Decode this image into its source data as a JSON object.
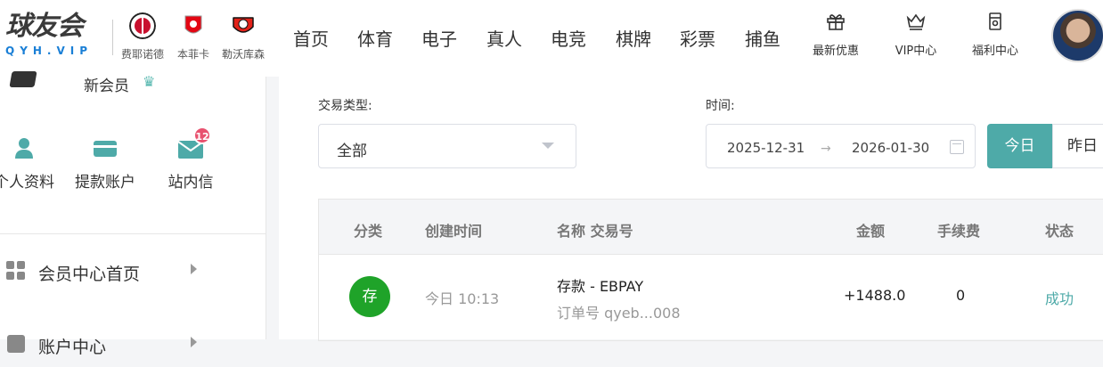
{
  "logo": {
    "main": "球友会",
    "sub": "QYH.VIP"
  },
  "clubs": [
    {
      "name": "费耶诺德",
      "color": "#c8102e"
    },
    {
      "name": "本菲卡",
      "color": "#e30613"
    },
    {
      "name": "勒沃库森",
      "color": "#e32219"
    }
  ],
  "nav": [
    "首页",
    "体育",
    "电子",
    "真人",
    "电竞",
    "棋牌",
    "彩票",
    "捕鱼"
  ],
  "utils": [
    {
      "label": "最新优惠",
      "icon": "gift-icon"
    },
    {
      "label": "VIP中心",
      "icon": "crown-icon"
    },
    {
      "label": "福利中心",
      "icon": "welfare-icon"
    }
  ],
  "sidebar": {
    "member_label": "新会员",
    "quick_actions": [
      {
        "label": "个人资料",
        "icon": "user-icon"
      },
      {
        "label": "提款账户",
        "icon": "card-icon"
      },
      {
        "label": "站内信",
        "icon": "mail-icon",
        "badge": "12"
      }
    ],
    "menu": [
      {
        "label": "会员中心首页",
        "icon": "grid-icon"
      },
      {
        "label": "账户中心",
        "icon": "account-icon"
      }
    ]
  },
  "filters": {
    "type_label": "交易类型:",
    "type_value": "全部",
    "time_label": "时间:",
    "date_start": "2025-12-31",
    "date_sep": "→",
    "date_end": "2026-01-30",
    "today": "今日",
    "yesterday": "昨日"
  },
  "table": {
    "headers": [
      "分类",
      "创建时间",
      "名称 交易号",
      "金额",
      "手续费",
      "状态"
    ],
    "rows": [
      {
        "type": "存",
        "time": "今日 10:13",
        "name": "存款 - EBPAY",
        "order": "订单号 qyeb...008",
        "amount": "+1488.0",
        "fee": "0",
        "status": "成功"
      }
    ]
  },
  "colors": {
    "accent": "#4eaaa8",
    "deposit": "#1fa329",
    "success": "#4eaaa8",
    "badge": "#e8526f"
  }
}
